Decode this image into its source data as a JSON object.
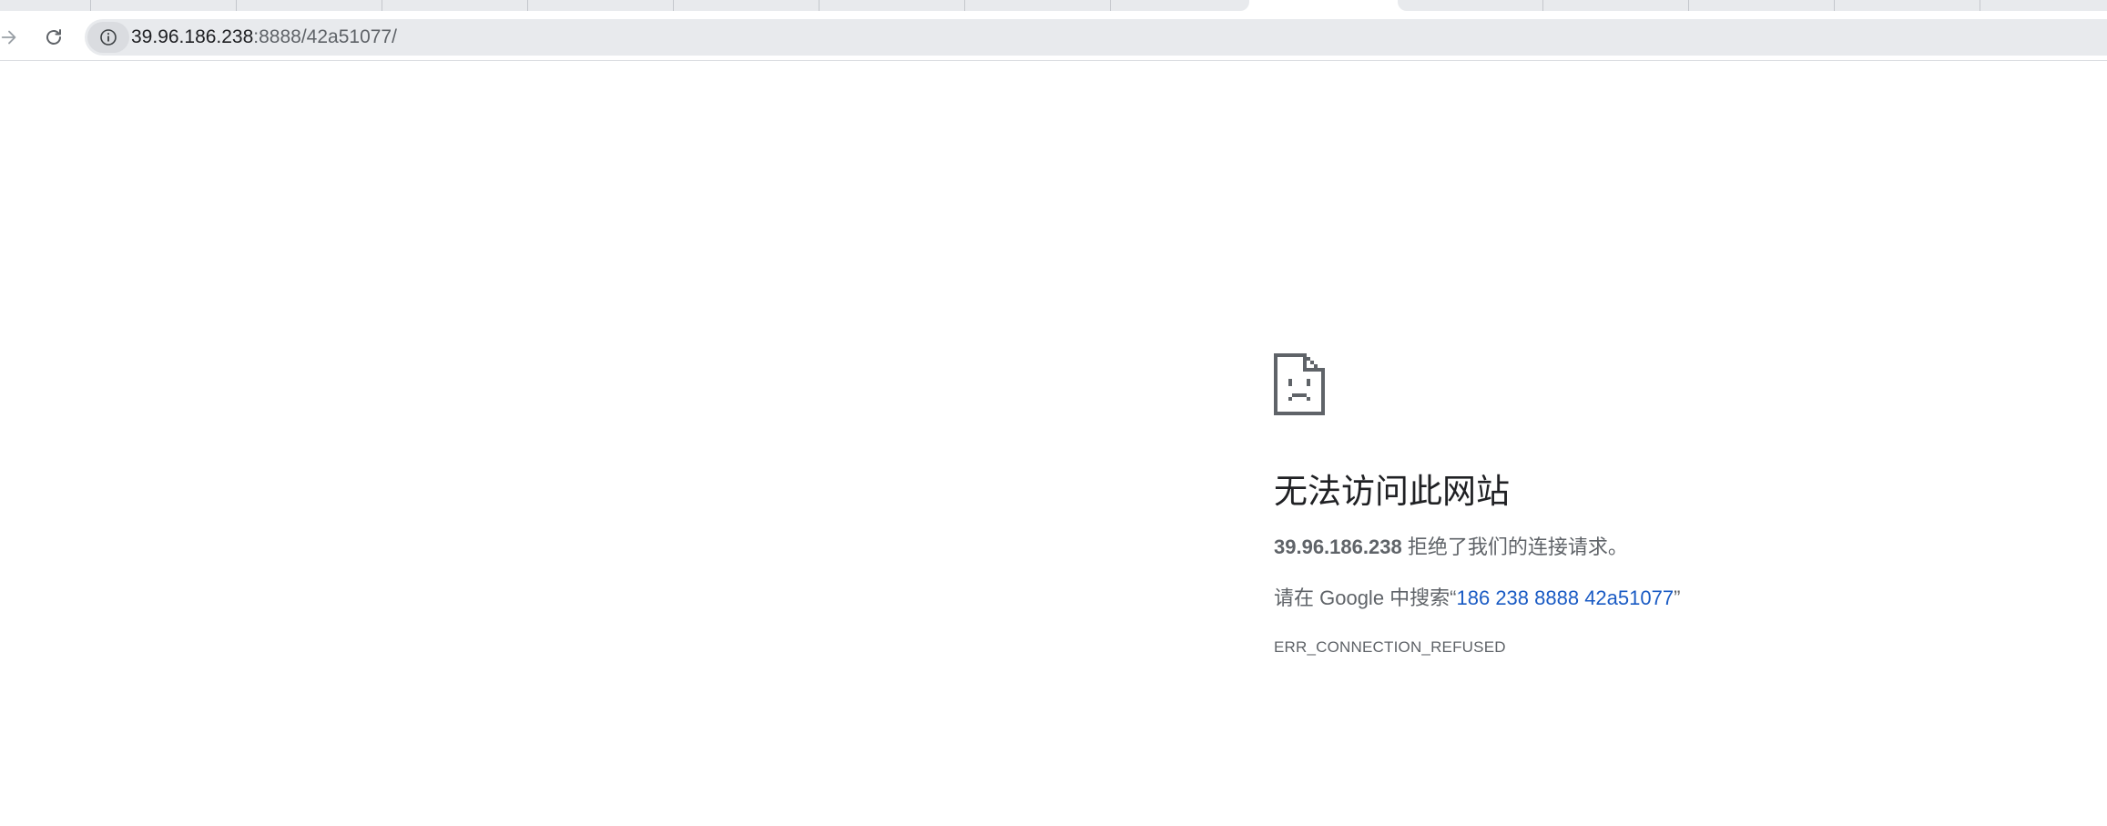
{
  "browser": {
    "url_host": "39.96.186.238",
    "url_rest": ":8888/42a51077/"
  },
  "error": {
    "title": "无法访问此网站",
    "host": "39.96.186.238",
    "message": "拒绝了我们的连接请求。",
    "suggest_prefix": "请在 Google 中搜索“",
    "suggest_link": "186 238 8888 42a51077",
    "suggest_suffix": "”",
    "code": "ERR_CONNECTION_REFUSED"
  },
  "colors": {
    "link": "#1a5bc4",
    "text": "#5f6368",
    "title": "#202124"
  }
}
